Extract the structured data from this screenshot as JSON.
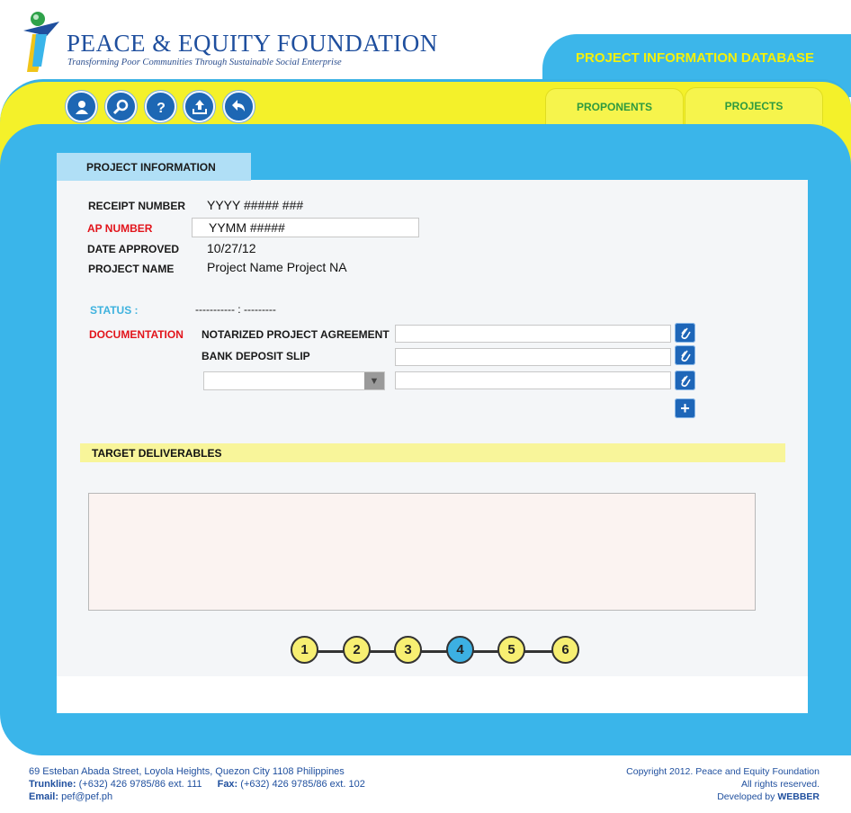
{
  "header": {
    "logo_title": "PEACE & EQUITY FOUNDATION",
    "logo_subtitle": "Transforming Poor Communities Through Sustainable Social Enterprise",
    "database_title": "PROJECT INFORMATION DATABASE"
  },
  "toolbar": {
    "icons": [
      "user-icon",
      "search-icon",
      "help-icon",
      "upload-icon",
      "back-icon"
    ]
  },
  "nav": {
    "tabs": [
      "PROPONENTS",
      "PROJECTS"
    ]
  },
  "section": {
    "title": "PROJECT INFORMATION"
  },
  "fields": {
    "receipt_label": "RECEIPT NUMBER",
    "receipt_value": "YYYY ##### ###",
    "ap_label": "AP NUMBER",
    "ap_value": "YYMM #####",
    "date_label": "DATE APPROVED",
    "date_value": "10/27/12",
    "project_label": "PROJECT NAME",
    "project_value": "Project Name Project NA",
    "status_label": "STATUS :",
    "status_value": "----------- : ---------"
  },
  "documentation": {
    "label": "DOCUMENTATION",
    "items": [
      "NOTARIZED PROJECT AGREEMENT",
      "BANK DEPOSIT SLIP"
    ],
    "select_value": ""
  },
  "deliverables": {
    "title": "TARGET DELIVERABLES",
    "text": ""
  },
  "steps": {
    "items": [
      "1",
      "2",
      "3",
      "4",
      "5",
      "6"
    ],
    "active": 4
  },
  "footer": {
    "address": "69 Esteban Abada Street, Loyola Heights, Quezon City 1108 Philippines",
    "trunkline_label": "Trunkline:",
    "trunkline_value": "(+632) 426 9785/86 ext. 111",
    "fax_label": "Fax:",
    "fax_value": "(+632) 426 9785/86 ext. 102",
    "email_label": "Email:",
    "email_value": "pef@pef.ph",
    "copyright": "Copyright 2012. Peace and Equity Foundation",
    "rights": "All rights reserved.",
    "developed_label": "Developed by",
    "developer": "WEBBER"
  },
  "colors": {
    "blue": "#3ab5ea",
    "yellow": "#f4f12a",
    "navy": "#1f4f9e",
    "red": "#e2141b",
    "green": "#2e9a3f"
  }
}
